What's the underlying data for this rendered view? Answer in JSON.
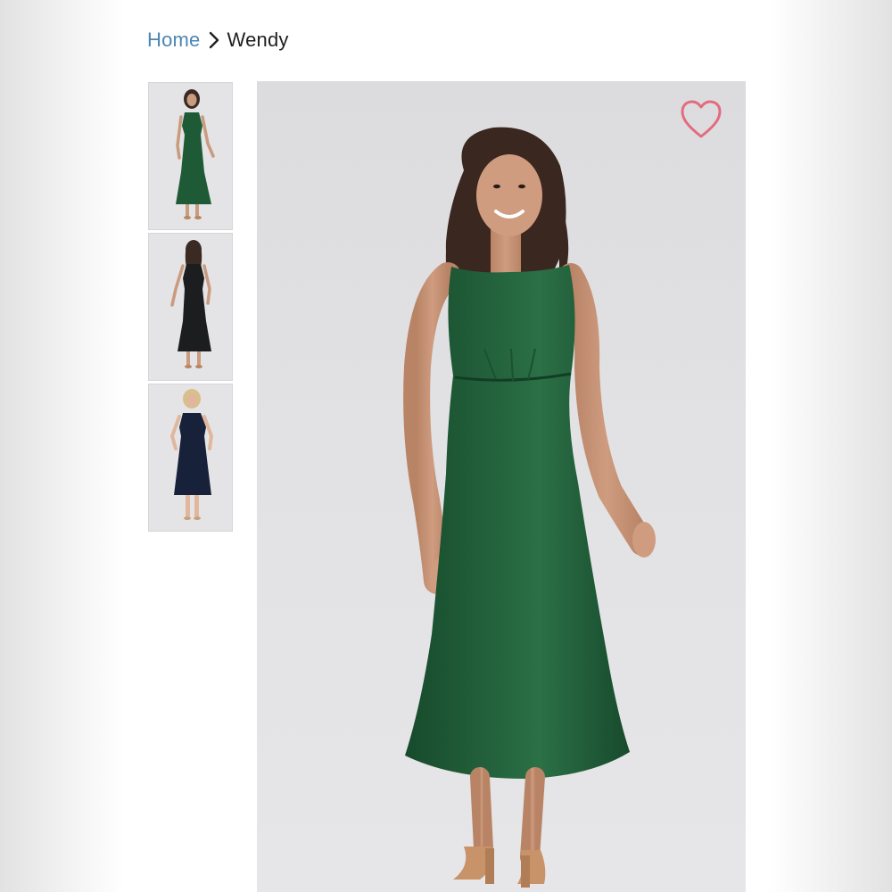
{
  "breadcrumb": {
    "home_label": "Home",
    "separator_icon": "chevron-right-icon",
    "current_label": "Wendy"
  },
  "gallery": {
    "thumbnails": [
      {
        "color": "#1f5a36",
        "view": "front"
      },
      {
        "color": "#1c1d1e",
        "view": "back"
      },
      {
        "color": "#17213a",
        "view": "front"
      }
    ],
    "main_image_color": "#1f5a36"
  },
  "wishlist": {
    "icon": "heart-icon",
    "color": "#e36b7f"
  }
}
